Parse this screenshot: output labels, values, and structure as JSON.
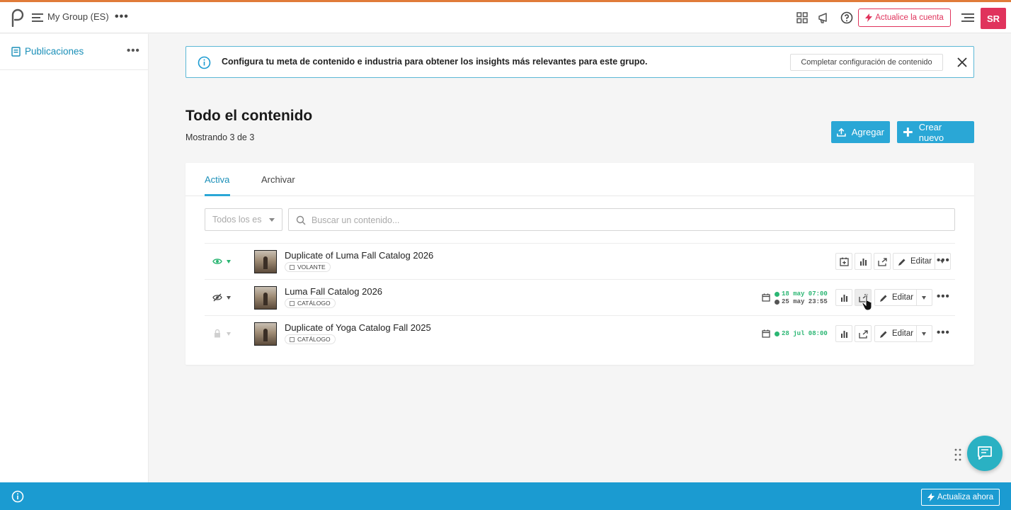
{
  "topbar": {
    "group_name": "My Group (ES)",
    "upgrade_label": "Actualice la cuenta",
    "avatar_initials": "SR"
  },
  "sidebar": {
    "items": [
      {
        "label": "Publicaciones"
      }
    ]
  },
  "banner": {
    "message": "Configura tu meta de contenido e industria para obtener los insights más relevantes para este grupo.",
    "button_label": "Completar configuración de contenido"
  },
  "page": {
    "title": "Todo el contenido",
    "subtitle": "Mostrando 3 de 3",
    "add_label": "Agregar",
    "create_label": "Crear nuevo"
  },
  "tabs": [
    {
      "label": "Activa"
    },
    {
      "label": "Archivar"
    }
  ],
  "filter": {
    "select_value": "Todos los es",
    "search_placeholder": "Buscar un contenido..."
  },
  "rows": [
    {
      "title": "Duplicate of Luma Fall Catalog 2026",
      "tag": "VOLANTE",
      "visibility_icon": "eye-icon",
      "schedule": [],
      "edit_label": "Editar"
    },
    {
      "title": "Luma Fall Catalog 2026",
      "tag": "CATÁLOGO",
      "visibility_icon": "eye-off-icon",
      "schedule": [
        "18 may 07:00",
        "25 may 23:55"
      ],
      "edit_label": "Editar"
    },
    {
      "title": "Duplicate of Yoga Catalog Fall 2025",
      "tag": "CATÁLOGO",
      "visibility_icon": "lock-icon",
      "schedule": [
        "28 jul 08:00"
      ],
      "edit_label": "Editar"
    }
  ],
  "bottombar": {
    "button_label": "Actualiza ahora"
  },
  "colors": {
    "accent": "#2aa7d6",
    "brand_pink": "#e0335c",
    "bottom_bar": "#1b9bd1",
    "schedule_start": "#2bb673",
    "schedule_end": "#666666"
  }
}
